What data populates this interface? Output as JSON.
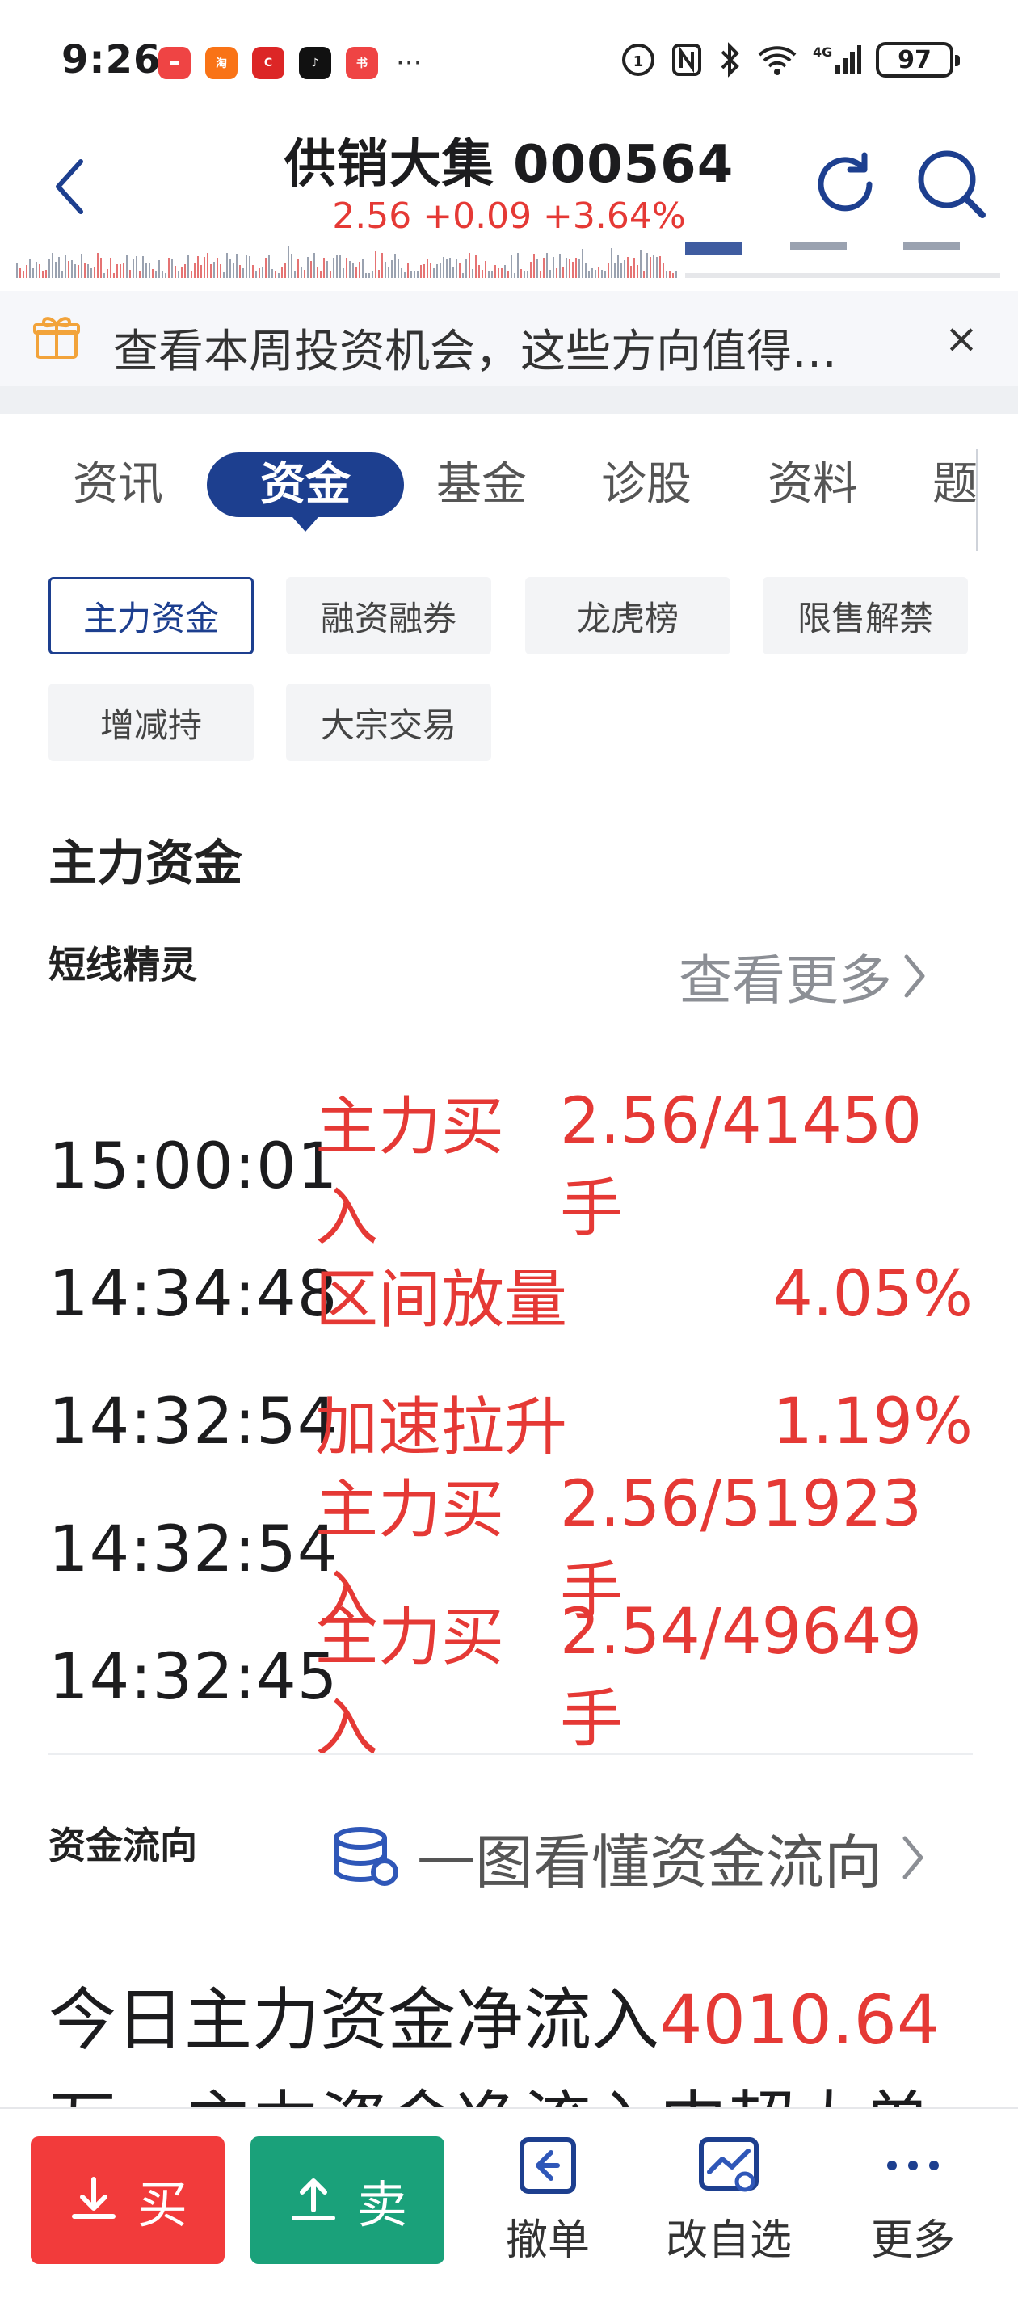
{
  "status_bar": {
    "time": "9:26",
    "dots": "···",
    "battery": "97"
  },
  "header": {
    "title": "供销大集 000564",
    "quote": "2.56 +0.09 +3.64%"
  },
  "banner": {
    "text": "查看本周投资机会，这些方向值得…",
    "close": "×"
  },
  "tabs": [
    "资讯",
    "资金",
    "基金",
    "诊股",
    "资料",
    "题"
  ],
  "active_tab": "资金",
  "subtabs": [
    "主力资金",
    "融资融券",
    "龙虎榜",
    "限售解禁",
    "增减持",
    "大宗交易"
  ],
  "active_subtab": "主力资金",
  "section": {
    "title": "主力资金",
    "subtitle": "短线精灵",
    "see_more": "查看更多"
  },
  "signals": [
    {
      "time": "15:00:01",
      "type": "主力买入",
      "value": "2.56/41450手"
    },
    {
      "time": "14:34:48",
      "type": "区间放量",
      "value": "4.05%"
    },
    {
      "time": "14:32:54",
      "type": "加速拉升",
      "value": "1.19%"
    },
    {
      "time": "14:32:54",
      "type": "主力买入",
      "value": "2.56/51923手"
    },
    {
      "time": "14:32:45",
      "type": "主力买入",
      "value": "2.54/49649手"
    }
  ],
  "flow": {
    "title": "资金流向",
    "link": "一图看懂资金流向"
  },
  "summary": {
    "prefix": "今日主力资金净流入",
    "amount": "4010.64",
    "line2": "万，主力资金净流入中超大单"
  },
  "bottom_bar": {
    "buy": "买",
    "sell": "卖",
    "cancel": "撤单",
    "edit_watchlist": "改自选",
    "more": "更多"
  },
  "colors": {
    "accent": "#1d3f8f",
    "up_red": "#e53935",
    "buy": "#f23b3b",
    "sell": "#1aa17a"
  }
}
